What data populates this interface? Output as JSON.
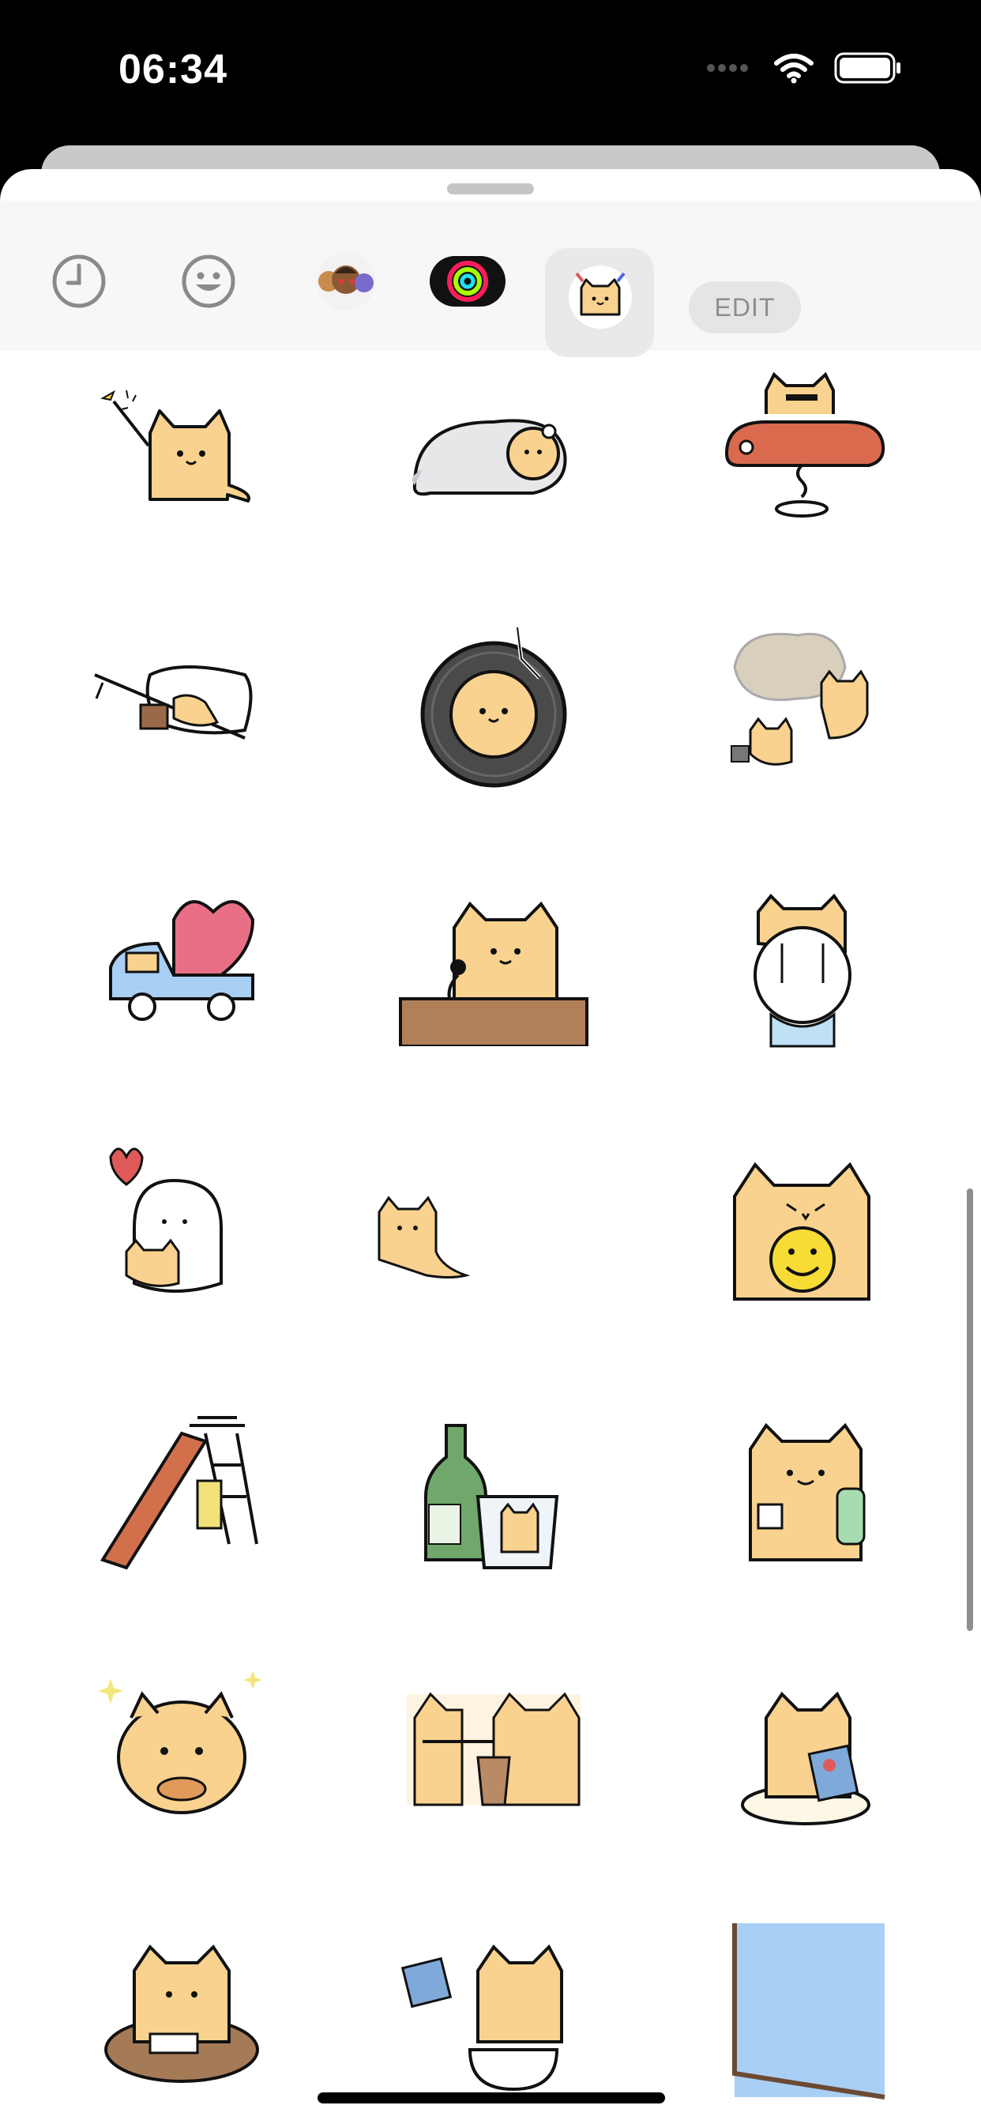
{
  "status_bar": {
    "time": "06:34"
  },
  "toolbar": {
    "items": [
      "clock-icon",
      "smiley-icon",
      "memoji-stickers",
      "activity-rings",
      "cat-sticker-pack"
    ],
    "edit_label": "EDIT"
  },
  "colors": {
    "cat_fill": "#f8d28e",
    "outline": "#111111",
    "accent_red": "#e05a5a",
    "accent_blue": "#a9cff5"
  },
  "stickers": [
    "cat-sparkler",
    "cat-sleeping-bag",
    "cat-car-ride",
    "cat-bed-drink",
    "cat-record",
    "cat-cloud-dream",
    "cat-heart-truck",
    "cat-microphone",
    "cat-hugging-ghost",
    "ghost-with-heart",
    "cat-small",
    "cat-smiley-ball",
    "cat-slide",
    "cat-bottle-glass",
    "cat-drinks",
    "cat-eating-sparkles",
    "cats-bubble-tea",
    "cat-snack-bag",
    "cat-desk-writing",
    "cat-toilet",
    "cat-window"
  ]
}
